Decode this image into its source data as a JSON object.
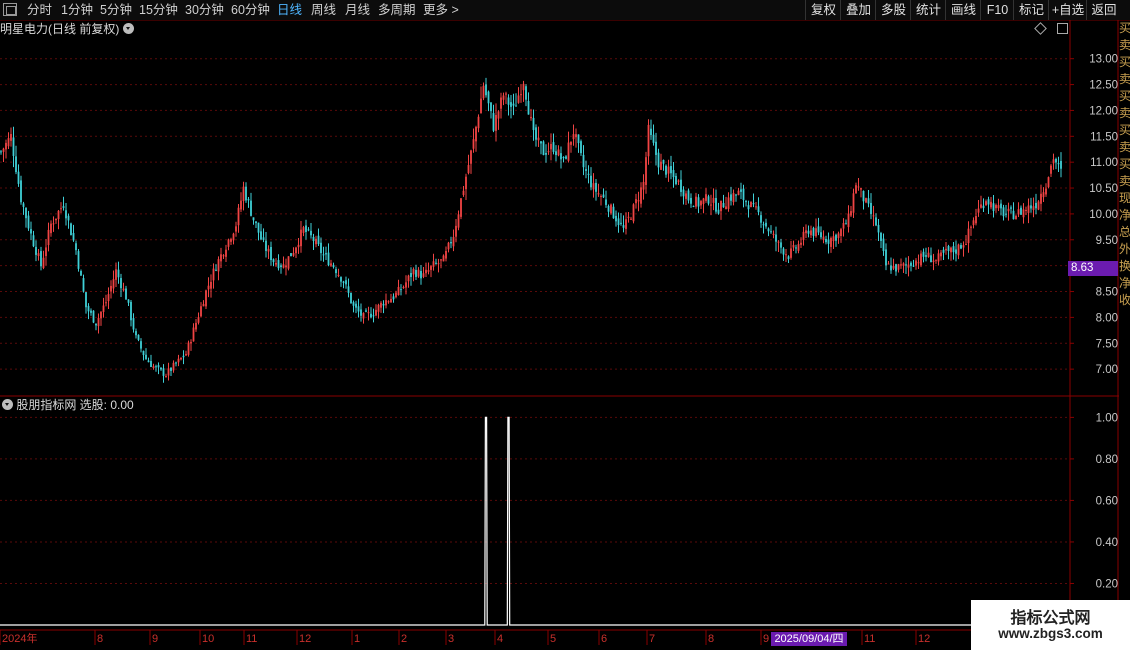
{
  "toolbar": {
    "periods": [
      {
        "label": "分时",
        "active": false
      },
      {
        "label": "1分钟",
        "active": false
      },
      {
        "label": "5分钟",
        "active": false
      },
      {
        "label": "15分钟",
        "active": false
      },
      {
        "label": "30分钟",
        "active": false
      },
      {
        "label": "60分钟",
        "active": false
      },
      {
        "label": "日线",
        "active": true
      },
      {
        "label": "周线",
        "active": false
      },
      {
        "label": "月线",
        "active": false
      },
      {
        "label": "多周期",
        "active": false
      },
      {
        "label": "更多 >",
        "active": false
      }
    ],
    "right_buttons": [
      "复权",
      "叠加",
      "多股",
      "统计",
      "画线",
      "F10",
      "标记",
      "+自选",
      "返回"
    ]
  },
  "chart_title": "明星电力(日线 前复权)",
  "indicator_title": "股朋指标网 选股: 0.00",
  "price_tag": "8.63",
  "date_tag": "2025/09/04/四",
  "right_panel_text": "买卖买卖买卖买卖买卖现净总外换净收",
  "watermark": {
    "line1": "指标公式网",
    "line2": "www.zbgs3.com"
  },
  "colors": {
    "up": "#f24444",
    "down": "#3fd0d8",
    "grid": "#5a0a0a",
    "axis": "#8a0000",
    "accent": "#4fb6ff",
    "tag": "#6b1bb0"
  },
  "chart_data": [
    {
      "type": "candlestick",
      "title": "明星电力(日线 前复权)",
      "yticks": [
        7.0,
        7.5,
        8.0,
        8.5,
        9.0,
        9.5,
        10.0,
        10.5,
        11.0,
        11.5,
        12.0,
        12.5,
        13.0
      ],
      "ylim": [
        6.5,
        13.4
      ],
      "xticks": [
        "2024年",
        "8",
        "9",
        "10",
        "11",
        "12",
        "1",
        "2",
        "3",
        "4",
        "5",
        "6",
        "7",
        "8",
        "9",
        "10",
        "11",
        "12"
      ],
      "close_path": [
        [
          0,
          11.2
        ],
        [
          4,
          11.5
        ],
        [
          8,
          10.3
        ],
        [
          12,
          9.6
        ],
        [
          16,
          9.0
        ],
        [
          20,
          9.8
        ],
        [
          25,
          10.2
        ],
        [
          30,
          9.3
        ],
        [
          34,
          8.2
        ],
        [
          38,
          7.9
        ],
        [
          42,
          8.3
        ],
        [
          46,
          8.9
        ],
        [
          50,
          8.4
        ],
        [
          54,
          7.6
        ],
        [
          58,
          7.2
        ],
        [
          62,
          7.0
        ],
        [
          66,
          6.9
        ],
        [
          70,
          7.1
        ],
        [
          74,
          7.3
        ],
        [
          78,
          7.9
        ],
        [
          82,
          8.5
        ],
        [
          86,
          9.0
        ],
        [
          90,
          9.4
        ],
        [
          94,
          9.8
        ],
        [
          97,
          10.5
        ],
        [
          101,
          9.9
        ],
        [
          105,
          9.4
        ],
        [
          109,
          9.1
        ],
        [
          113,
          9.0
        ],
        [
          117,
          9.3
        ],
        [
          121,
          9.7
        ],
        [
          125,
          9.5
        ],
        [
          129,
          9.2
        ],
        [
          133,
          9.0
        ],
        [
          137,
          8.7
        ],
        [
          141,
          8.2
        ],
        [
          145,
          8.0
        ],
        [
          149,
          8.1
        ],
        [
          153,
          8.3
        ],
        [
          157,
          8.4
        ],
        [
          161,
          8.6
        ],
        [
          165,
          8.9
        ],
        [
          169,
          8.8
        ],
        [
          173,
          9.0
        ],
        [
          177,
          9.1
        ],
        [
          181,
          9.6
        ],
        [
          185,
          10.5
        ],
        [
          189,
          11.4
        ],
        [
          193,
          12.5
        ],
        [
          197,
          11.7
        ],
        [
          201,
          12.3
        ],
        [
          205,
          12.0
        ],
        [
          209,
          12.6
        ],
        [
          213,
          11.5
        ],
        [
          217,
          11.2
        ],
        [
          221,
          11.3
        ],
        [
          225,
          11.0
        ],
        [
          229,
          11.6
        ],
        [
          233,
          10.9
        ],
        [
          237,
          10.5
        ],
        [
          241,
          10.3
        ],
        [
          245,
          10.0
        ],
        [
          249,
          9.7
        ],
        [
          253,
          10.1
        ],
        [
          257,
          10.6
        ],
        [
          259,
          11.6
        ],
        [
          263,
          11.0
        ],
        [
          267,
          10.8
        ],
        [
          271,
          10.6
        ],
        [
          275,
          10.3
        ],
        [
          279,
          10.2
        ],
        [
          283,
          10.3
        ],
        [
          287,
          10.1
        ],
        [
          291,
          10.3
        ],
        [
          295,
          10.4
        ],
        [
          299,
          10.2
        ],
        [
          303,
          10.0
        ],
        [
          307,
          9.7
        ],
        [
          311,
          9.4
        ],
        [
          315,
          9.2
        ],
        [
          319,
          9.4
        ],
        [
          323,
          9.7
        ],
        [
          327,
          9.6
        ],
        [
          331,
          9.5
        ],
        [
          335,
          9.6
        ],
        [
          339,
          9.9
        ],
        [
          342,
          10.6
        ],
        [
          346,
          10.2
        ],
        [
          350,
          9.8
        ],
        [
          354,
          9.0
        ],
        [
          358,
          8.95
        ],
        [
          362,
          9.0
        ],
        [
          366,
          9.1
        ],
        [
          370,
          9.2
        ],
        [
          374,
          9.1
        ],
        [
          378,
          9.25
        ],
        [
          382,
          9.3
        ],
        [
          386,
          9.5
        ],
        [
          390,
          10.0
        ],
        [
          394,
          10.3
        ],
        [
          398,
          10.1
        ],
        [
          402,
          10.0
        ],
        [
          406,
          10.0
        ],
        [
          410,
          10.1
        ],
        [
          414,
          10.2
        ],
        [
          418,
          10.6
        ],
        [
          421,
          11.1
        ],
        [
          424,
          10.8
        ]
      ],
      "note_spikes": []
    },
    {
      "type": "line",
      "title": "股朋指标网 选股",
      "yticks": [
        0.2,
        0.4,
        0.6,
        0.8,
        1.0
      ],
      "ylim": [
        0,
        1.05
      ],
      "series": [
        {
          "name": "选股",
          "signal_x": [
            194,
            203
          ],
          "value_on": 1.0,
          "value_off": 0.0
        }
      ]
    }
  ]
}
